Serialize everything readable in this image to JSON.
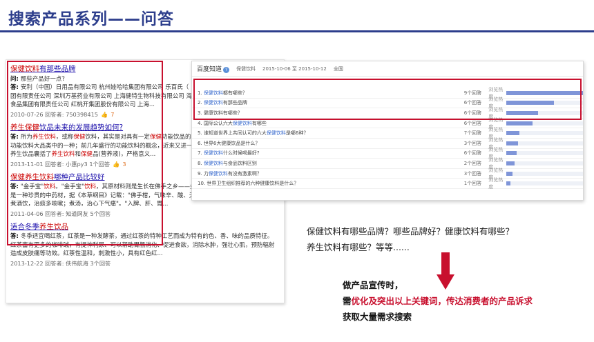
{
  "title": "搜索产品系列——问答",
  "results": [
    {
      "title_parts": [
        {
          "t": "保健饮料",
          "hl": true
        },
        {
          "t": "有那些品牌",
          "hl": false
        }
      ],
      "lines": [
        [
          {
            "t": "问: ",
            "b": true
          },
          {
            "t": "那些产品好一点?"
          }
        ],
        [
          {
            "t": "答: ",
            "b": true
          },
          {
            "t": "安利（中国）日用品有限公司 杭州娃哈哈集团有限公司 乐百氏（"
          }
        ],
        [
          {
            "t": "团有限责任公司 深圳万基药业有限公司 上海健特生物科技有限公司 海"
          }
        ],
        [
          {
            "t": "食品集团有限责任公司 红桃开集团股份有限公司 上海..."
          }
        ]
      ],
      "meta": "2010-07-26   回答者: 750398415",
      "likes": "7"
    },
    {
      "title_parts": [
        {
          "t": "养生保健",
          "hl": true
        },
        {
          "t": "饮品未来的发展趋势如何?",
          "hl": false
        }
      ],
      "lines": [
        [
          {
            "t": "答: ",
            "b": true
          },
          {
            "t": "所为"
          },
          {
            "t": "养生饮料",
            "kw": true
          },
          {
            "t": "，或称"
          },
          {
            "t": "保健",
            "kw": true
          },
          {
            "t": "饮料，其实是对具有一定"
          },
          {
            "t": "保健",
            "kw": true
          },
          {
            "t": "功能饮品的"
          }
        ],
        [
          {
            "t": "功能饮料大品类中的一种；前几年盛行的功能饮料的概念，近来又进一"
          }
        ],
        [
          {
            "t": "养生饮品囊括了"
          },
          {
            "t": "养生饮料",
            "kw": true
          },
          {
            "t": "和"
          },
          {
            "t": "保健",
            "kw": true
          },
          {
            "t": "品(营养液)，严格意义..."
          }
        ]
      ],
      "meta": "2013-11-01   回答者: 小惠py3   1个回答",
      "likes": "3"
    },
    {
      "title_parts": [
        {
          "t": "保健养生饮料",
          "hl": true
        },
        {
          "t": "哪种产品比较好",
          "hl": false
        }
      ],
      "lines": [
        [
          {
            "t": "答: ",
            "b": true
          },
          {
            "t": "\"金手宝\""
          },
          {
            "t": "饮料",
            "kw": true
          },
          {
            "t": "。\"金手宝\""
          },
          {
            "t": "饮料",
            "kw": true
          },
          {
            "t": "，其原材料则是生长在佛手之乡——金华的新鲜、成熟佛手。佛手，"
          }
        ],
        [
          {
            "t": "是一种珍贵的中药材，据《本草纲目》记载：\"佛手柑，气味辛、酸、无毒，主治下气，降心头痰水，"
          }
        ],
        [
          {
            "t": "煮酒饮，治痰多咳嗽；煮汤，治心下气痛\"。\"入脾、肝、胃..."
          }
        ]
      ],
      "meta": "2011-04-06   回答者: 知道网友   5个回答",
      "likes": ""
    },
    {
      "title_parts": [
        {
          "t": "适合冬季",
          "hl": false
        },
        {
          "t": "养生饮品",
          "hl": true
        }
      ],
      "lines": [
        [
          {
            "t": "答: ",
            "b": true
          },
          {
            "t": "冬季适宜喝红茶，红茶是一种发酵茶，通过红茶的特种工艺而成为特有的色、香、味的品质特征。"
          }
        ],
        [
          {
            "t": "红茶富有更多的咖啡碱，有提神利尿、可以帮助胃肠消化、促进食欲，消除水肿，强壮心肌，预防辐射"
          }
        ],
        [
          {
            "t": "造成皮肤痛等功效。红茶性温和，刺激性小，具有红色红..."
          }
        ]
      ],
      "meta": "2013-12-22   回答者: 佚伟航海   3个回答",
      "likes": ""
    }
  ],
  "zhidao": {
    "logo": "百度知道",
    "badge": "?",
    "keyword": "保健饮料",
    "date_range": "2015-10-06 至 2015-10-12",
    "scope": "全国",
    "hot_label": "浏览热度",
    "rows": [
      {
        "idx": "1.",
        "parts": [
          {
            "t": "保健饮料",
            "kw": true
          },
          {
            "t": "都有哪些？"
          }
        ],
        "count": "9个回答",
        "heat": 1.0
      },
      {
        "idx": "2.",
        "parts": [
          {
            "t": "保健饮料",
            "kw": true
          },
          {
            "t": "有那些品牌"
          }
        ],
        "count": "6个回答",
        "heat": 0.62
      },
      {
        "idx": "3.",
        "parts": [
          {
            "t": "健康饮料有哪些？"
          }
        ],
        "count": "6个回答",
        "heat": 0.41
      },
      {
        "idx": "4.",
        "parts": [
          {
            "t": "国际公认六大"
          },
          {
            "t": "保健饮料",
            "kw": true
          },
          {
            "t": "有哪些"
          }
        ],
        "count": "6个回答",
        "heat": 0.34
      },
      {
        "idx": "5.",
        "parts": [
          {
            "t": "谁知道世界上共同认可的六大"
          },
          {
            "t": "保健饮料",
            "kw": true
          },
          {
            "t": "是哪6种？"
          }
        ],
        "count": "7个回答",
        "heat": 0.17
      },
      {
        "idx": "6.",
        "parts": [
          {
            "t": "世界6大健康饮品是什么？"
          }
        ],
        "count": "3个回答",
        "heat": 0.15
      },
      {
        "idx": "7.",
        "parts": [
          {
            "t": "保健饮料",
            "kw": true
          },
          {
            "t": "什么时候喝最好?"
          }
        ],
        "count": "6个回答",
        "heat": 0.13
      },
      {
        "idx": "8.",
        "parts": [
          {
            "t": "保健饮料",
            "kw": true
          },
          {
            "t": "与食品饮料区别"
          }
        ],
        "count": "2个回答",
        "heat": 0.11
      },
      {
        "idx": "9.",
        "parts": [
          {
            "t": "力"
          },
          {
            "t": "保健饮料",
            "kw": true
          },
          {
            "t": "有没有激素啊？"
          }
        ],
        "count": "3个回答",
        "heat": 0.08
      },
      {
        "idx": "10.",
        "parts": [
          {
            "t": "世界卫生组织推荐的六种健康饮料是什么？"
          }
        ],
        "count": "1个回答",
        "heat": 0.05
      }
    ]
  },
  "desc_lines": [
    "保健饮料有哪些品牌？哪些品牌好？健康饮料有哪些？",
    "养生饮料有哪些？等等......"
  ],
  "summary": {
    "line1": "做产品宣传时，",
    "line2_prefix": "需",
    "line2_red": "优化及突出以上关键词，传达消费者的产品诉求",
    "line3": "获取大量需求搜索"
  },
  "colors": {
    "accent": "#2d3e8c",
    "highlight_red": "#c8102e",
    "link": "#1a0dab",
    "bar": "#7f95d8"
  }
}
